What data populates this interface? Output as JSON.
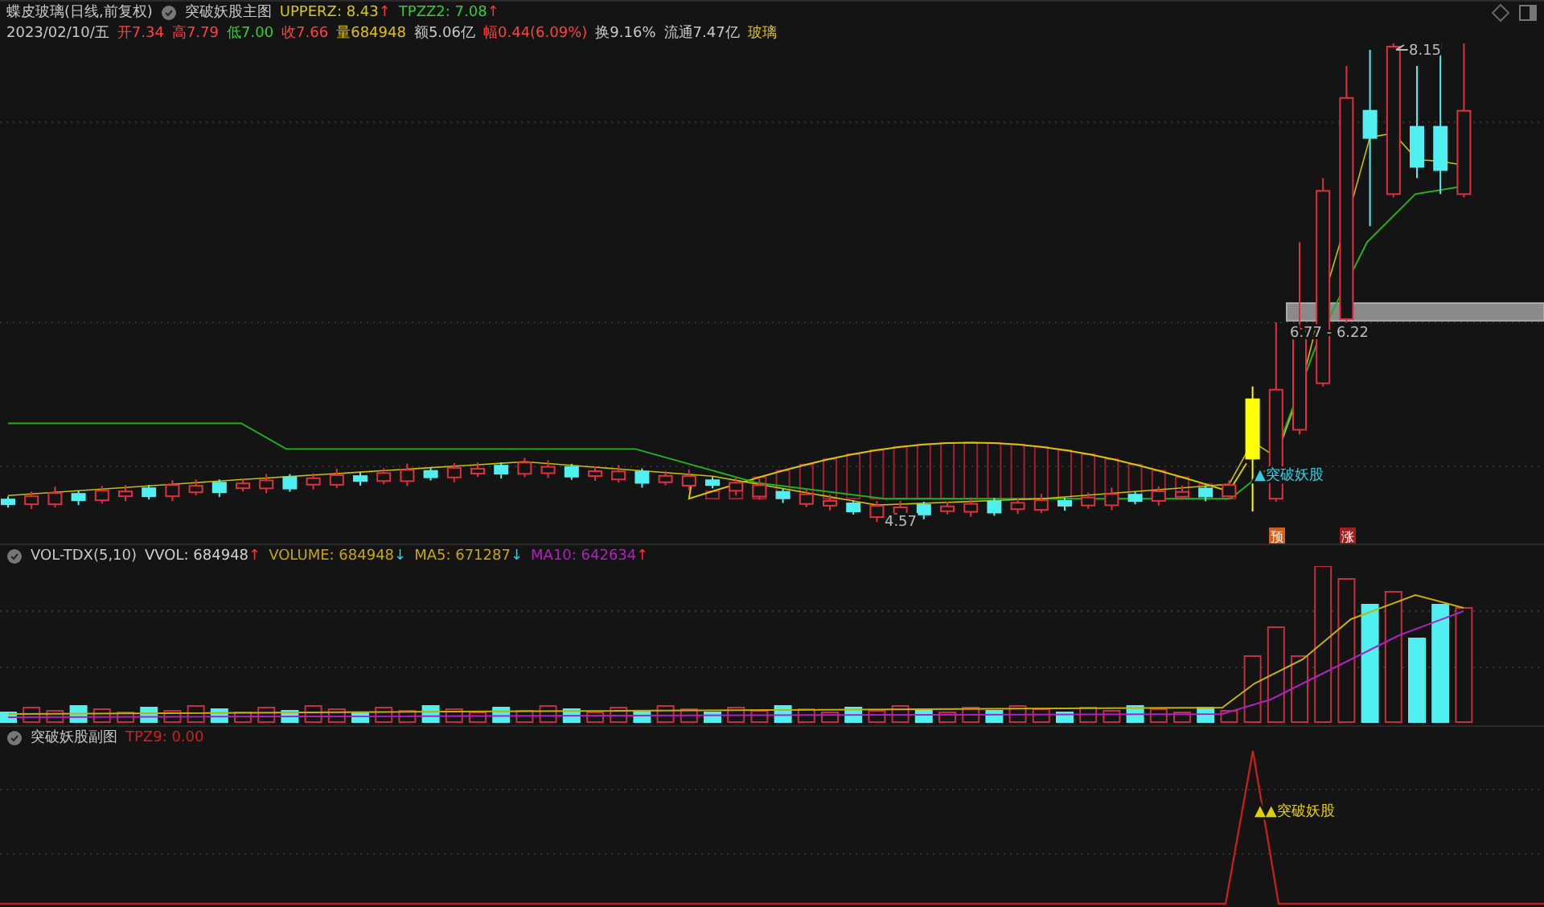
{
  "main_panel": {
    "title": "蝶皮玻璃(日线,前复权)",
    "indicator": "突破妖股主图",
    "values": [
      {
        "text": "UPPERZ: 8.43",
        "arrow": {
          "text": "↑",
          "color": "#ff3030"
        },
        "color": "#d8c800"
      },
      {
        "text": "TPZZ2: 7.08",
        "arrow": {
          "text": "↑",
          "color": "#ff3030"
        },
        "color": "#30d030"
      }
    ],
    "quote": [
      {
        "text": "2023/02/10/五",
        "color": "#c8c8c8"
      },
      {
        "text": "开7.34",
        "color": "#ff4040"
      },
      {
        "text": "高7.79",
        "color": "#ff4040"
      },
      {
        "text": "低7.00",
        "color": "#30d030"
      },
      {
        "text": "收7.66",
        "color": "#ff4040"
      },
      {
        "text": "量684948",
        "color": "#e0c000"
      },
      {
        "text": "额5.06亿",
        "color": "#c8c8c8"
      },
      {
        "text": "幅0.44(6.09%)",
        "color": "#ff4040"
      },
      {
        "text": "换9.16%",
        "color": "#c8c8c8"
      },
      {
        "text": "流通7.47亿",
        "color": "#c8c8c8"
      },
      {
        "text": "玻璃",
        "color": "#e0c000"
      }
    ],
    "high_label": "8.15",
    "range_label": "6.77 - 6.22",
    "low_label": "4.57",
    "signal_label": "▲突破妖股",
    "markers": [
      {
        "text": "预",
        "color": "#d06020"
      },
      {
        "text": "涨",
        "color": "#a02020"
      }
    ]
  },
  "volume_panel": {
    "indicator": "VOL-TDX(5,10)",
    "values": [
      {
        "text": "VVOL: 684948",
        "arrow": {
          "text": "↑",
          "color": "#ff3030"
        },
        "color": "#d0d0d0"
      },
      {
        "text": "VOLUME: 684948",
        "arrow": {
          "text": "↓",
          "color": "#30d0e0"
        },
        "color": "#c8a800"
      },
      {
        "text": "MA5: 671287",
        "arrow": {
          "text": "↓",
          "color": "#30d0e0"
        },
        "color": "#c8a800"
      },
      {
        "text": "MA10: 642634",
        "arrow": {
          "text": "↑",
          "color": "#ff3030"
        },
        "color": "#b020c0"
      }
    ]
  },
  "signal_panel": {
    "indicator": "突破妖股副图",
    "values": [
      {
        "text": "TPZ9: 0.00",
        "color": "#d02020"
      }
    ],
    "signal_label": "▲▲突破妖股"
  }
}
